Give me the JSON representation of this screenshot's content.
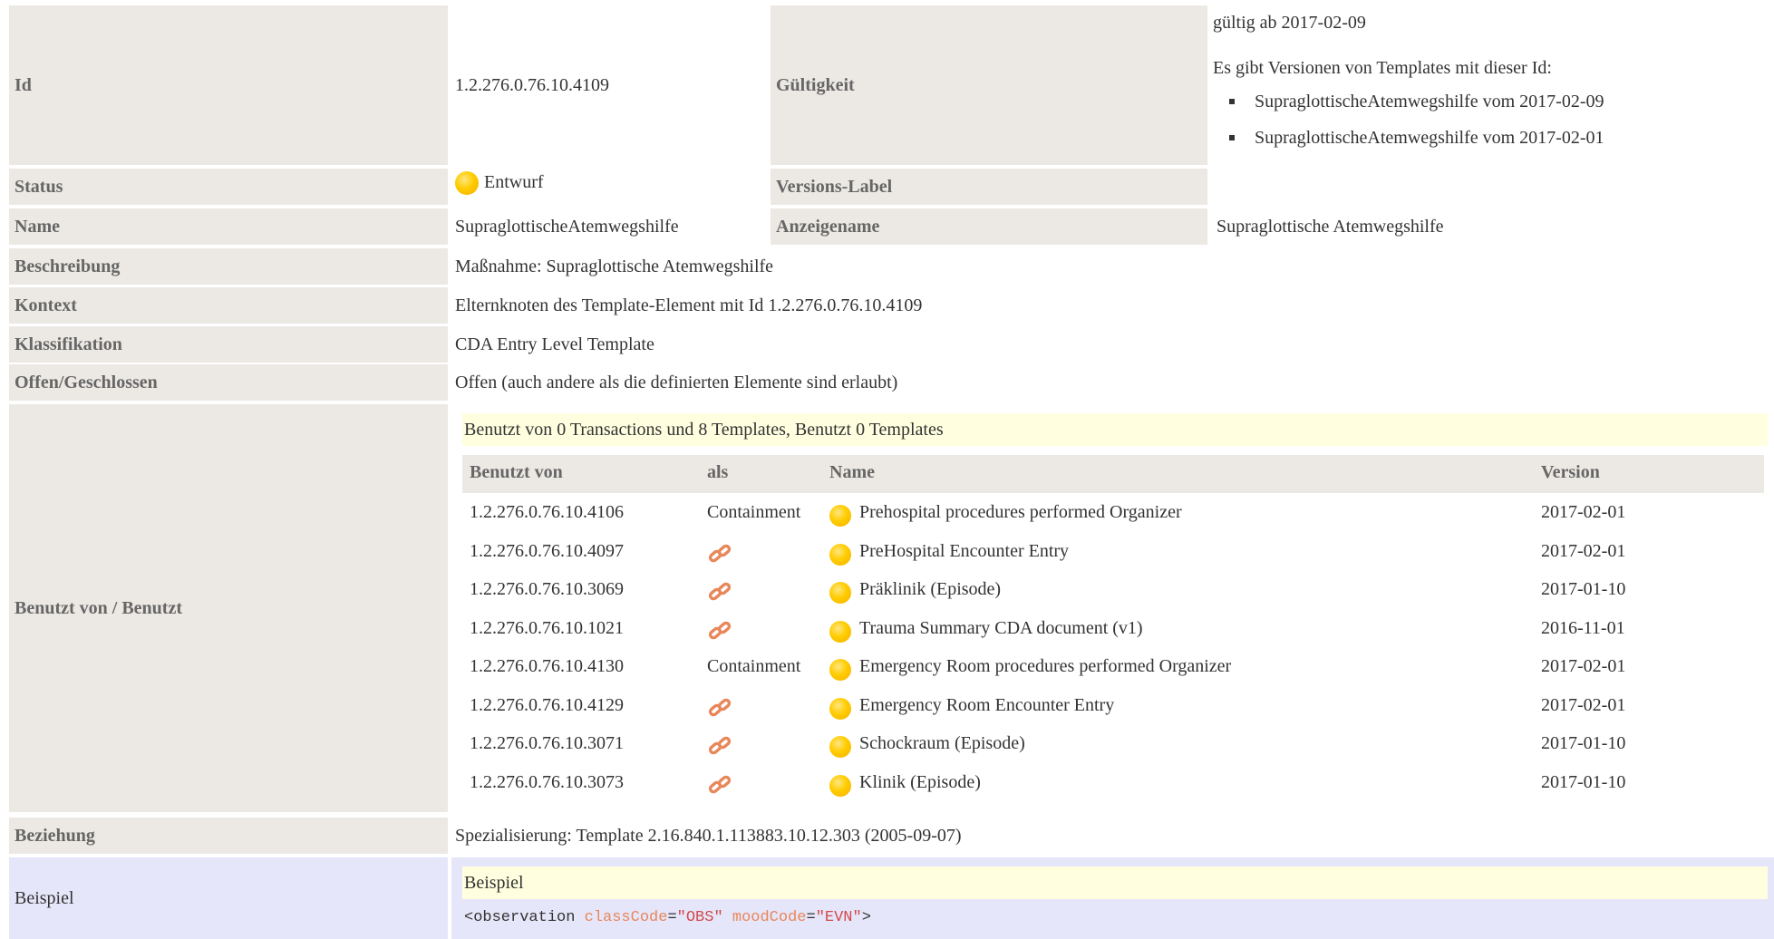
{
  "id": {
    "label": "Id",
    "value": "1.2.276.0.76.10.4109"
  },
  "validity": {
    "label": "Gültigkeit",
    "valid_from": "gültig ab 2017-02-09",
    "versions_intro": "Es gibt Versionen von Templates mit dieser Id:",
    "versions": [
      "SupraglottischeAtemwegshilfe vom 2017-02-09",
      "SupraglottischeAtemwegshilfe vom 2017-02-01"
    ]
  },
  "status": {
    "label": "Status",
    "value": "Entwurf",
    "icon": "draft-status-icon",
    "color": "#ffcc00"
  },
  "version_label": {
    "label": "Versions-Label",
    "value": ""
  },
  "name": {
    "label": "Name",
    "value": "SupraglottischeAtemwegshilfe"
  },
  "display_name": {
    "label": "Anzeigename",
    "value": "Supraglottische Atemwegshilfe"
  },
  "description": {
    "label": "Beschreibung",
    "value": "Maßnahme: Supraglottische Atemwegshilfe"
  },
  "context": {
    "label": "Kontext",
    "value": "Elternknoten des Template-Element mit Id 1.2.276.0.76.10.4109"
  },
  "classification": {
    "label": "Klassifikation",
    "value": "CDA Entry Level Template"
  },
  "open_closed": {
    "label": "Offen/Geschlossen",
    "value": "Offen (auch andere als die definierten Elemente sind erlaubt)"
  },
  "usage": {
    "label": "Benutzt von / Benutzt",
    "summary": "Benutzt von 0 Transactions und 8 Templates, Benutzt 0 Templates",
    "headers": {
      "used_by": "Benutzt von",
      "as": "als",
      "name": "Name",
      "version": "Version"
    },
    "rows": [
      {
        "id": "1.2.276.0.76.10.4106",
        "as": "Containment",
        "link": false,
        "name": "Prehospital procedures performed Organizer",
        "version": "2017-02-01"
      },
      {
        "id": "1.2.276.0.76.10.4097",
        "as": "",
        "link": true,
        "name": "PreHospital Encounter Entry",
        "version": "2017-02-01"
      },
      {
        "id": "1.2.276.0.76.10.3069",
        "as": "",
        "link": true,
        "name": "Präklinik (Episode)",
        "version": "2017-01-10"
      },
      {
        "id": "1.2.276.0.76.10.1021",
        "as": "",
        "link": true,
        "name": "Trauma Summary CDA document (v1)",
        "version": "2016-11-01"
      },
      {
        "id": "1.2.276.0.76.10.4130",
        "as": "Containment",
        "link": false,
        "name": "Emergency Room procedures performed Organizer",
        "version": "2017-02-01"
      },
      {
        "id": "1.2.276.0.76.10.4129",
        "as": "",
        "link": true,
        "name": "Emergency Room Encounter Entry",
        "version": "2017-02-01"
      },
      {
        "id": "1.2.276.0.76.10.3071",
        "as": "",
        "link": true,
        "name": "Schockraum (Episode)",
        "version": "2017-01-10"
      },
      {
        "id": "1.2.276.0.76.10.3073",
        "as": "",
        "link": true,
        "name": "Klinik (Episode)",
        "version": "2017-01-10"
      }
    ]
  },
  "relation": {
    "label": "Beziehung",
    "value": "Spezialisierung: Template 2.16.840.1.113883.10.12.303 (2005-09-07)"
  },
  "example": {
    "label": "Beispiel",
    "title": "Beispiel",
    "code": {
      "tag_open": "<observation",
      "attr1": "classCode",
      "eq": "=",
      "val1": "\"OBS\"",
      "attr2": "moodCode",
      "val2": "\"EVN\"",
      "tag_close": ">"
    }
  },
  "colors": {
    "label_bg": "#ece9e4",
    "usage_header_bg": "#ffffe0",
    "example_bg": "#e6e6fa",
    "status_yellow": "#ffcc00",
    "link_orange": "#e8875a"
  }
}
